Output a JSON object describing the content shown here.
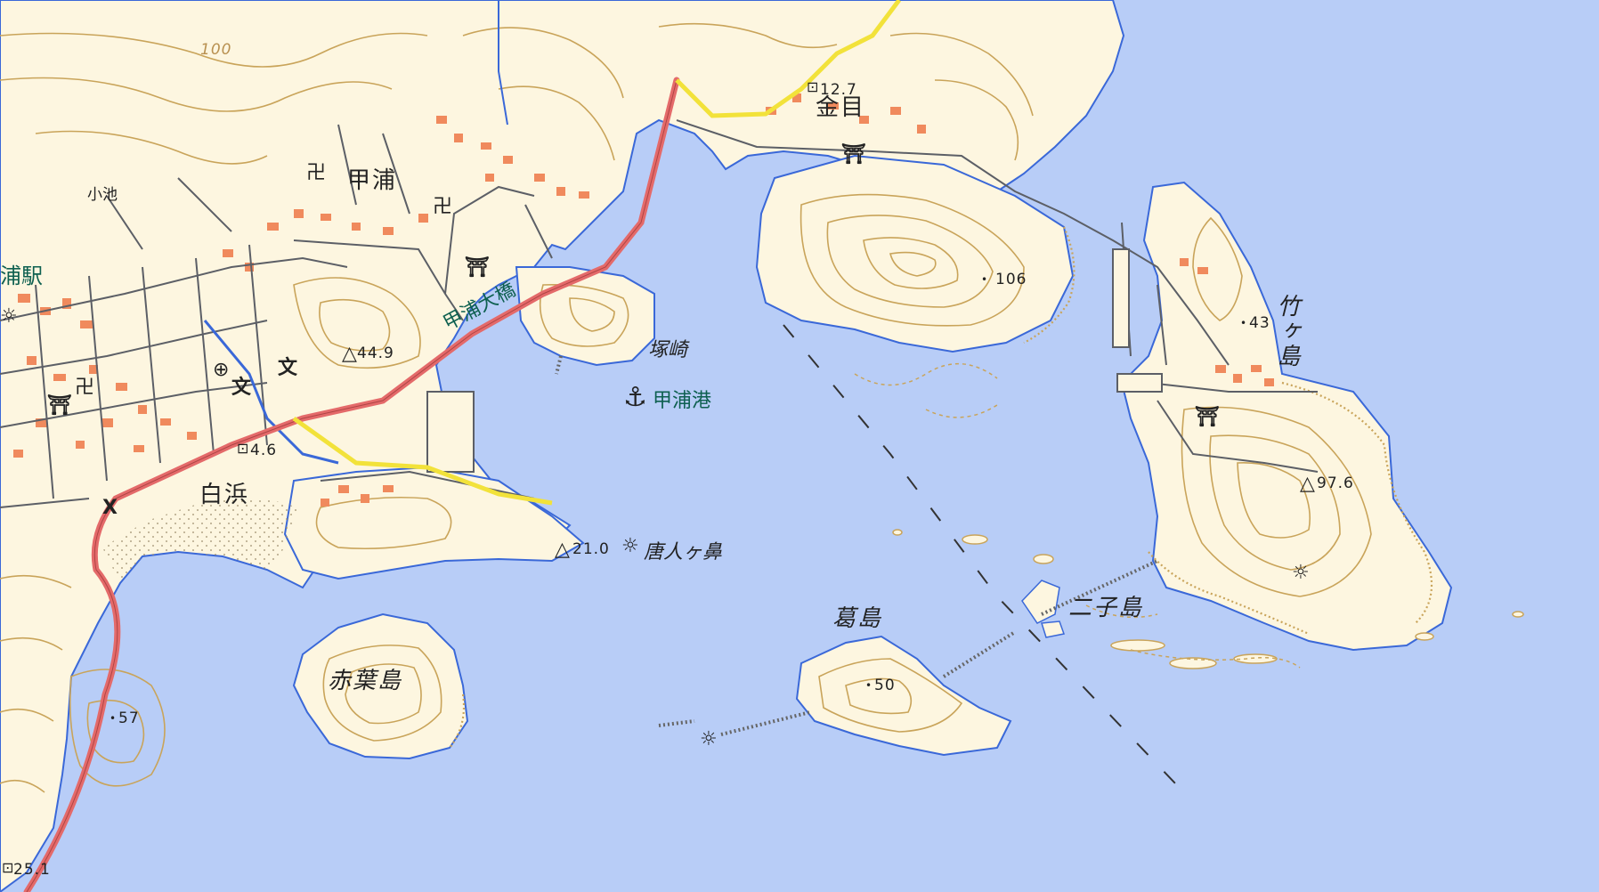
{
  "map": {
    "colors": {
      "water": "#b8cdf7",
      "land": "#fdf6e0",
      "contour": "#c9a45a",
      "national_road": "#e46a6a",
      "prefectural_road": "#f2e23a",
      "buildings": "#f08a5d",
      "shoreline": "#3a68d8",
      "station_text": "#0e6050"
    },
    "labels": {
      "koura": "甲浦",
      "shirahama": "白浜",
      "kanome": "金目",
      "koike": "小池",
      "station": "浦駅",
      "koura_bridge": "甲浦大橋",
      "tsukazaki": "塚崎",
      "koura_port": "甲浦港",
      "karatogahana": "唐人ヶ鼻",
      "akabajima": "赤葉島",
      "kazurajima": "葛島",
      "futagojima": "二子島",
      "takegashima": "竹ヶ島"
    },
    "elevations": {
      "e100": "100",
      "e12_7": "12.7",
      "e106": "106",
      "e43": "43",
      "e44_9": "44.9",
      "e4_6": "4.6",
      "e97_6": "97.6",
      "e21_0": "21.0",
      "e50": "50",
      "e57": "57",
      "e25_1": "25.1"
    },
    "icons": [
      "temple-icon",
      "shrine-icon",
      "anchor-icon",
      "lighthouse-icon",
      "post-office-icon",
      "school-icon",
      "police-box-icon",
      "triangulation-point-icon",
      "benchmark-icon"
    ]
  }
}
